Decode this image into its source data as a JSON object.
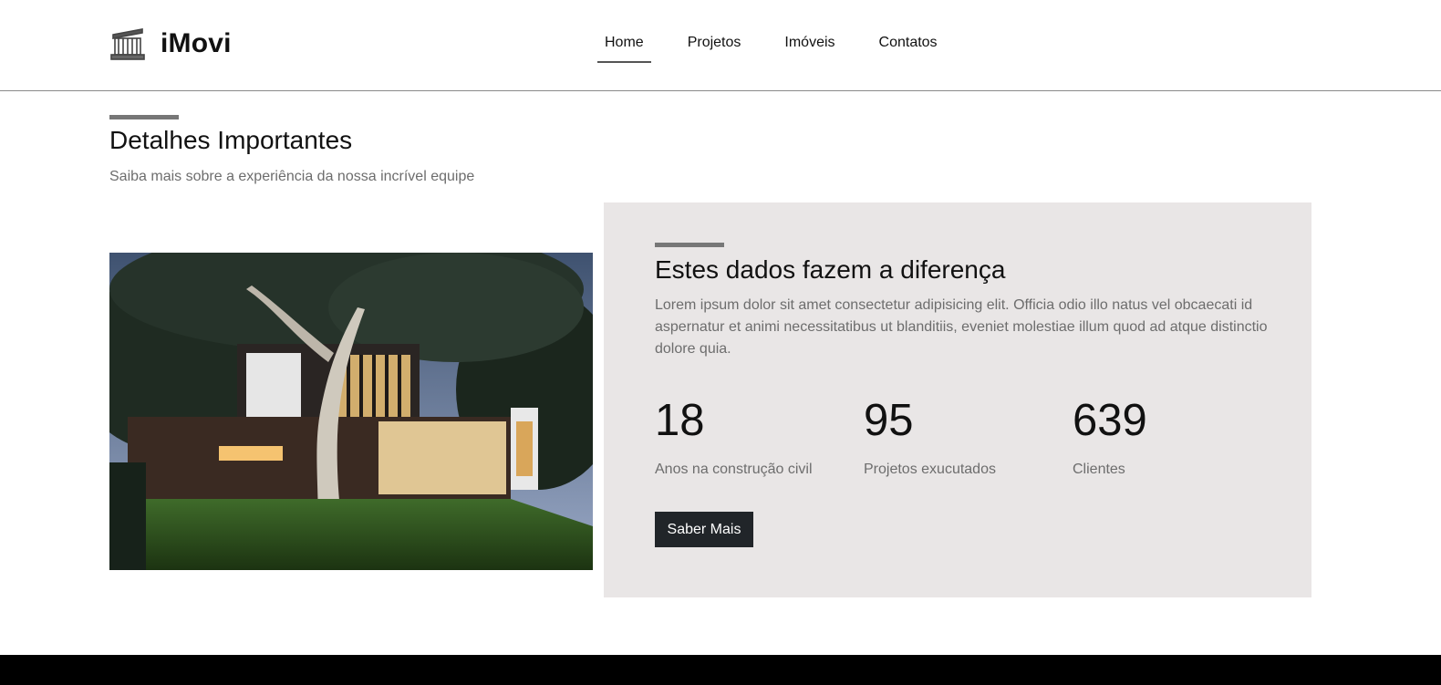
{
  "brand": {
    "name": "iMovi",
    "icon": "building-icon"
  },
  "nav": {
    "items": [
      {
        "label": "Home",
        "active": true
      },
      {
        "label": "Projetos",
        "active": false
      },
      {
        "label": "Imóveis",
        "active": false
      },
      {
        "label": "Contatos",
        "active": false
      }
    ]
  },
  "section": {
    "title": "Detalhes Importantes",
    "subtitle": "Saiba mais sobre a experiência da nossa incrível equipe"
  },
  "panel": {
    "title": "Estes dados fazem a diferença",
    "text": "Lorem ipsum dolor sit amet consectetur adipisicing elit. Officia odio illo natus vel obcaecati id aspernatur et animi necessitatibus ut blanditiis, eveniet molestiae illum quod ad atque distinctio dolore quia.",
    "stats": [
      {
        "value": "18",
        "label": "Anos na construção civil"
      },
      {
        "value": "95",
        "label": "Projetos exucutados"
      },
      {
        "value": "639",
        "label": "Clientes"
      }
    ],
    "button_label": "Saber Mais"
  },
  "colors": {
    "panel_bg": "#e9e6e6",
    "button_bg": "#212529",
    "accent": "#777777",
    "footer": "#000000"
  }
}
